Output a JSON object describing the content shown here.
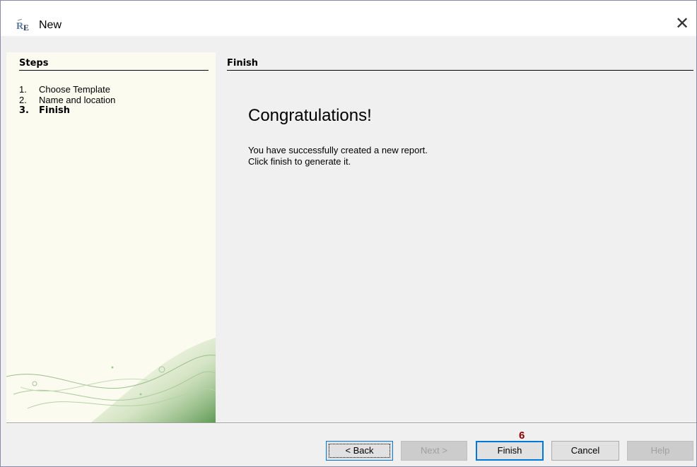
{
  "window": {
    "title": "New",
    "close_label": "✕"
  },
  "steps": {
    "title": "Steps",
    "items": [
      {
        "num": "1.",
        "label": "Choose Template"
      },
      {
        "num": "2.",
        "label": "Name and location"
      },
      {
        "num": "3.",
        "label": "Finish"
      }
    ],
    "current": 3
  },
  "content": {
    "title": "Finish",
    "heading": "Congratulations!",
    "line1": "You have successfully created a new report.",
    "line2": "Click finish to generate it."
  },
  "buttons": {
    "back": "< Back",
    "next": "Next >",
    "finish": "Finish",
    "cancel": "Cancel",
    "help": "Help"
  },
  "annotation": {
    "badge": "6"
  },
  "colors": {
    "accent": "#0078d7",
    "badge": "#8b0000",
    "steps_bg": "#fbfbf0"
  }
}
